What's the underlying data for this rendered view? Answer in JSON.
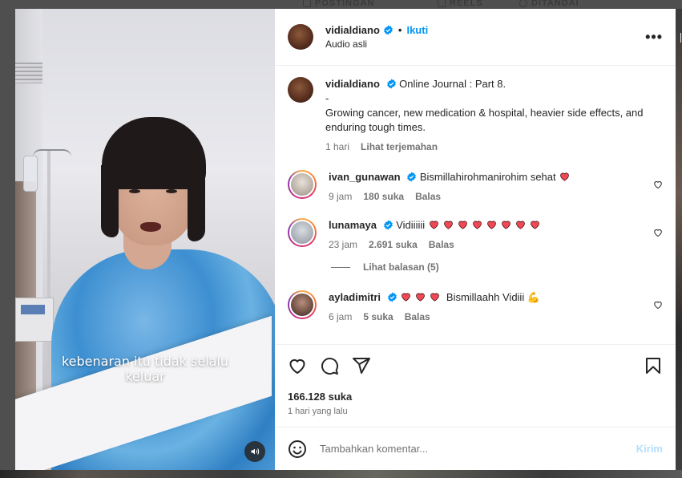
{
  "background_tabs": [
    {
      "label": "POSTINGAN",
      "icon": "grid-icon"
    },
    {
      "label": "REELS",
      "icon": "reels-icon"
    },
    {
      "label": "DITANDAI",
      "icon": "tagged-icon"
    }
  ],
  "video": {
    "caption_line1": "kebenaran itu tidak selalu",
    "caption_line2": "keluar",
    "mute_icon": "speaker-icon"
  },
  "header": {
    "username": "vidialdiano",
    "separator": "•",
    "follow_label": "Ikuti",
    "audio_label": "Audio asli",
    "more_icon": "more-icon",
    "more_glyph": "•••"
  },
  "caption_post": {
    "username": "vidialdiano",
    "title": "Online Journal : Part 8.",
    "dash": "-",
    "body": "Growing cancer, new medication & hospital, heavier side effects, and enduring tough times.",
    "time": "1 hari",
    "translate_label": "Lihat terjemahan"
  },
  "comments": [
    {
      "username": "ivan_gunawan",
      "text": "Bismillahirohmanirohim sehat",
      "hearts": 1,
      "hearts_position": "after",
      "time": "9 jam",
      "likes": "180 suka",
      "reply_label": "Balas"
    },
    {
      "username": "lunamaya",
      "text": "Vidiiiiii",
      "hearts": 8,
      "hearts_position": "after",
      "time": "23 jam",
      "likes": "2.691 suka",
      "reply_label": "Balas",
      "view_replies": "Lihat balasan (5)"
    },
    {
      "username": "ayladimitri",
      "text": "Bismillaahh Vidiii",
      "hearts": 3,
      "hearts_position": "before",
      "emoji": "💪",
      "time": "6 jam",
      "likes": "5 suka",
      "reply_label": "Balas"
    }
  ],
  "actions": {
    "like_icon": "heart-icon",
    "comment_icon": "comment-icon",
    "share_icon": "share-icon",
    "save_icon": "bookmark-icon"
  },
  "likes_count": "166.128 suka",
  "posted_date": "1 hari yang lalu",
  "add_comment": {
    "placeholder": "Tambahkan komentar...",
    "post_label": "Kirim",
    "emoji_icon": "emoji-icon"
  },
  "colors": {
    "accent": "#0095f6",
    "verified": "#0095f6",
    "heart_red": "#ed4956",
    "muted_text": "#737373",
    "post_disabled": "#b2dffc"
  }
}
